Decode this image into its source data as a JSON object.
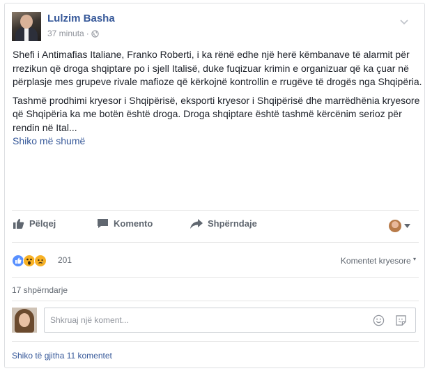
{
  "post": {
    "author": "Lulzim Basha",
    "time": "37 minuta",
    "meta_separator": "·",
    "paragraph1": "Shefi i Antimafias Italiane, Franko Roberti, i ka rënë edhe një herë këmbanave të alarmit për rrezikun që droga shqiptare po i sjell Italisë, duke fuqizuar krimin e organizuar që ka çuar në përplasje mes grupeve rivale mafioze që kërkojnë kontrollin e rrugëve të drogës nga Shqipëria.",
    "paragraph2": "Tashmë prodhimi kryesor i Shqipërisë, eksporti kryesor i Shqipërisë dhe marrëdhënia kryesore që Shqipëria ka me botën është droga. Droga shqiptare është tashmë kërcënim serioz për rendin në Ital...",
    "see_more": "Shiko më shumë"
  },
  "actions": {
    "like": "Pëlqej",
    "comment": "Komento",
    "share": "Shpërndaje"
  },
  "reactions": {
    "count": "201",
    "types": [
      "like",
      "wow",
      "sad"
    ],
    "top_comments": "Komentet kryesore"
  },
  "shares": "17 shpërndarje",
  "comment_input": {
    "placeholder": "Shkruaj një koment..."
  },
  "view_all_comments": "Shiko të gjitha 11 komentet",
  "colors": {
    "link": "#365899",
    "text": "#1d2129",
    "muted": "#606770",
    "like_blue": "#5890ff",
    "reaction_yellow": "#f7b125"
  },
  "icons": [
    "chevron-down-icon",
    "globe-icon",
    "thumbs-up-icon",
    "comment-icon",
    "share-arrow-icon",
    "emoji-icon",
    "sticker-icon"
  ]
}
